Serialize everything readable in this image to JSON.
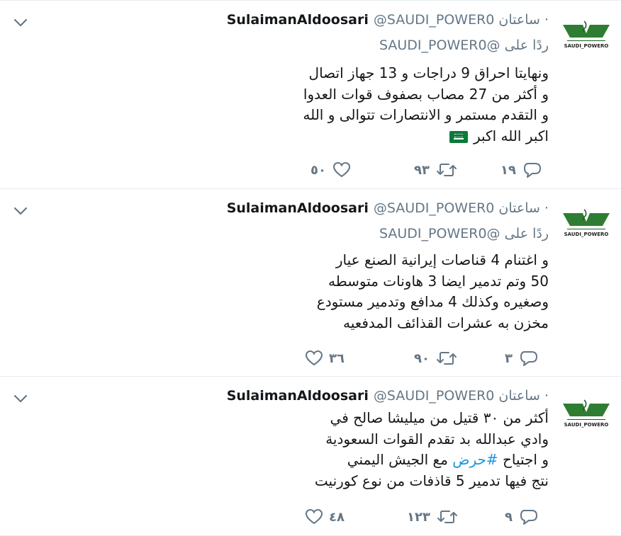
{
  "colors": {
    "text": "#14171a",
    "muted": "#657786",
    "link": "#1b95e0",
    "border": "#e6ecf0",
    "flag_green": "#0c7a3a"
  },
  "icons": {
    "menu": "chevron-down-icon",
    "reply": "reply-bubble-icon",
    "retweet": "retweet-icon",
    "like": "heart-icon",
    "flag": "saudi-flag-emoji",
    "avatar": "saudi-power-logo"
  },
  "tweets": [
    {
      "name": "SulaimanAldoosari",
      "handle": "@SAUDI_POWER0",
      "time": "ساعتان",
      "reply_prefix": "ردًا على",
      "reply_mention": "@SAUDI_POWER0",
      "avatar_caption": "SAUDI_POWERO",
      "lines": [
        "ونهايتا احراق 9 دراجات و 13 جهاز اتصال",
        "و أكثر من 27 مصاب بصفوف قوات العدوا",
        "و التقدم مستمر و الانتصارات تتوالى و الله",
        "اكبر الله اكبر"
      ],
      "replies": "١٩",
      "retweets": "٩٣",
      "likes": "٥٠"
    },
    {
      "name": "SulaimanAldoosari",
      "handle": "@SAUDI_POWER0",
      "time": "ساعتان",
      "reply_prefix": "ردًا على",
      "reply_mention": "@SAUDI_POWER0",
      "avatar_caption": "SAUDI_POWERO",
      "lines": [
        "و اغتنام 4 قناصات إيرانية الصنع عيار",
        "50 وتم تدمير ايضا 3 هاونات متوسطه",
        "وصغيره وكذلك 4 مدافع وتدمير مستودع",
        "مخزن به عشرات القذائف المدفعيه"
      ],
      "replies": "٣",
      "retweets": "٩٠",
      "likes": "٣٦"
    },
    {
      "name": "SulaimanAldoosari",
      "handle": "@SAUDI_POWER0",
      "time": "ساعتان",
      "avatar_caption": "SAUDI_POWERO",
      "lines": [
        "أكثر من ٣٠ قتيل من ميليشا صالح في",
        "وادي عبدالله بد تقدم القوات السعودية",
        "و اجتياح",
        "نتج فيها تدمير 5 قاذفات من نوع كورنيت"
      ],
      "line3_hashtag": "#حرض",
      "line3_suffix": "مع الجيش اليمني",
      "replies": "٩",
      "retweets": "١٢٣",
      "likes": "٤٨"
    }
  ]
}
